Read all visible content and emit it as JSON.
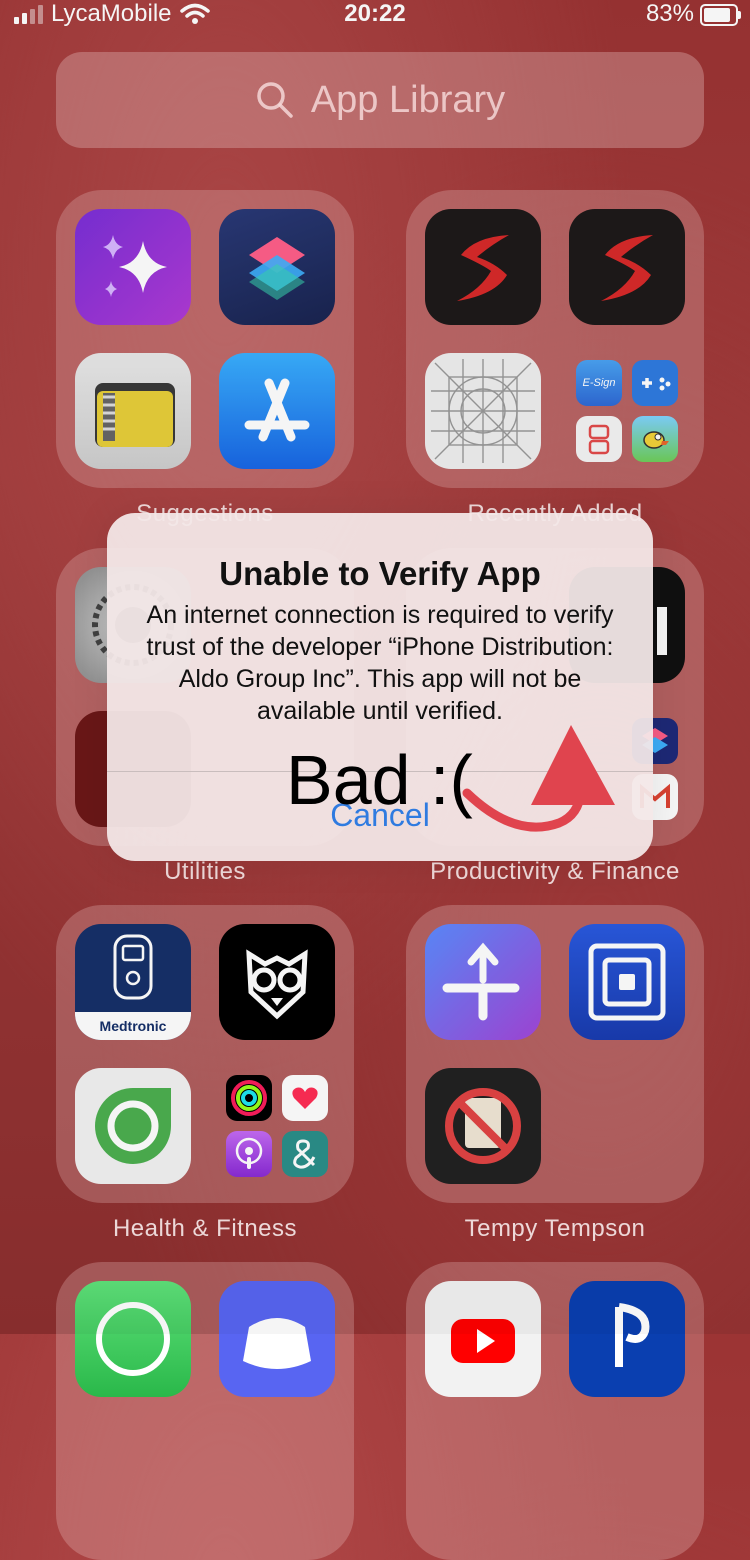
{
  "status_bar": {
    "carrier": "LycaMobile",
    "time": "20:22",
    "battery": "83%"
  },
  "search": {
    "placeholder": "App Library"
  },
  "folders": [
    {
      "label": "Suggestions"
    },
    {
      "label": "Recently Added"
    },
    {
      "label": "Utilities"
    },
    {
      "label": "Productivity & Finance"
    },
    {
      "label": "Health & Fitness"
    },
    {
      "label": "Tempy Tempson"
    }
  ],
  "apps": {
    "medtronic_label": "Medtronic",
    "esign_label": "E-Sign"
  },
  "dialog": {
    "title": "Unable to Verify App",
    "message": "An internet connection is required to verify trust of the developer “iPhone Distribution: Aldo Group Inc”. This app will not be available until verified.",
    "cancel": "Cancel"
  },
  "annotation": {
    "text": "Bad :(",
    "arrow_color": "#e0444e"
  },
  "colors": {
    "accent_blue": "#2f7be0"
  }
}
